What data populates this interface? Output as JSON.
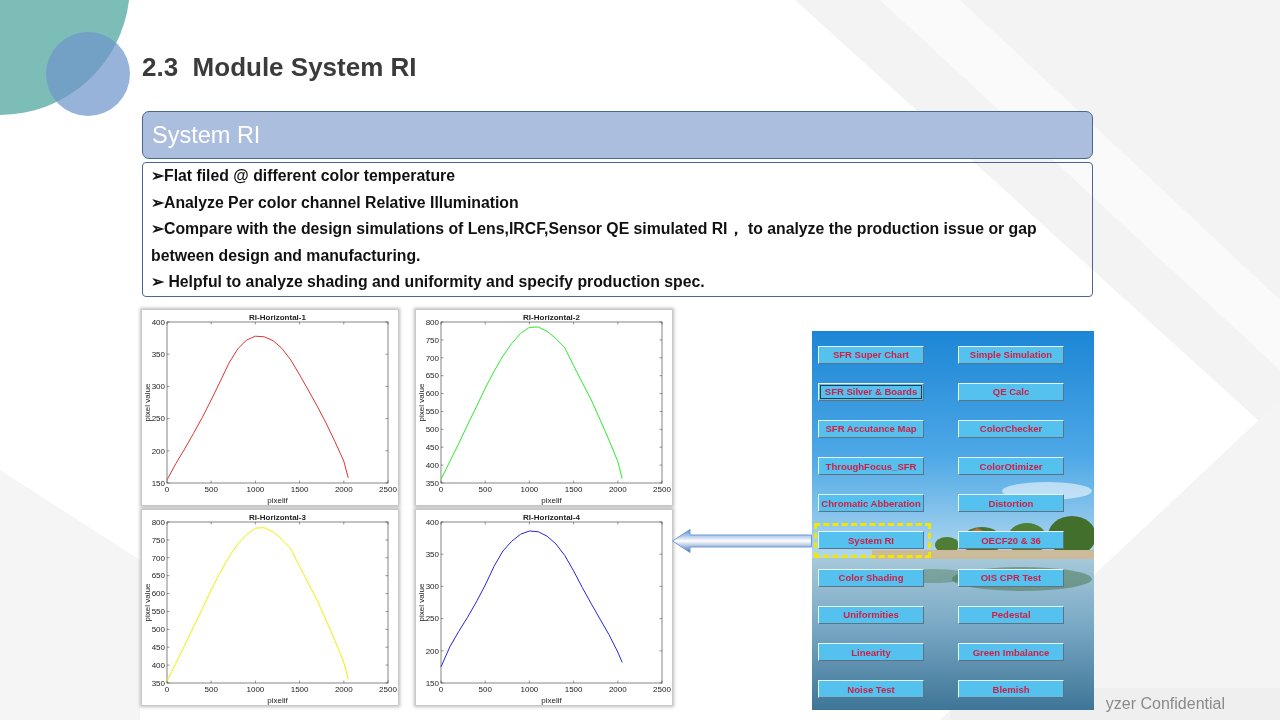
{
  "slide": {
    "title": "2.3  Module System RI"
  },
  "section_header": {
    "title": "System RI"
  },
  "bullets": [
    "➢Flat filed @ different color temperature",
    "➢Analyze Per color channel Relative Illumination",
    "➢Compare with the design simulations of Lens,IRCF,Sensor QE simulated RI， to analyze the production issue or gap between design and manufacturing.",
    "➢ Helpful to analyze shading and uniformity and specify production spec."
  ],
  "charts": [
    {
      "chart_data": {
        "type": "line",
        "title": "RI-Horizontal-1",
        "xlabel": "pixelif",
        "ylabel": "pixel value",
        "x": [
          0,
          100,
          200,
          300,
          400,
          500,
          600,
          700,
          800,
          900,
          1000,
          1100,
          1200,
          1300,
          1400,
          1500,
          1600,
          1700,
          1800,
          1900,
          2000,
          2050
        ],
        "series": [
          {
            "color": "#e0352f",
            "values": [
              155,
              180,
              203,
              227,
              252,
              279,
              307,
              336,
              358,
              372,
              378,
              377,
              371,
              359,
              341,
              318,
              294,
              269,
              243,
              214,
              184,
              158
            ]
          }
        ],
        "xlim": [
          0,
          2500
        ],
        "ylim": [
          150,
          400
        ],
        "xticks": [
          0,
          500,
          1000,
          1500,
          2000,
          2500
        ],
        "yticks": [
          150,
          200,
          250,
          300,
          350,
          400
        ]
      }
    },
    {
      "chart_data": {
        "type": "line",
        "title": "RI-Horizontal-2",
        "xlabel": "pixelif",
        "ylabel": "pixel value",
        "x": [
          0,
          100,
          200,
          300,
          400,
          500,
          600,
          700,
          800,
          900,
          1000,
          1100,
          1200,
          1300,
          1400,
          1500,
          1600,
          1700,
          1800,
          1900,
          2000,
          2050
        ],
        "series": [
          {
            "color": "#2ee82e",
            "values": [
              360,
              410,
              460,
              512,
              563,
              615,
              662,
              705,
              740,
              768,
              785,
              786,
              774,
              754,
              728,
              678,
              630,
              582,
              527,
              470,
              410,
              362
            ]
          }
        ],
        "xlim": [
          0,
          2500
        ],
        "ylim": [
          350,
          800
        ],
        "xticks": [
          0,
          500,
          1000,
          1500,
          2000,
          2500
        ],
        "yticks": [
          350,
          400,
          450,
          500,
          550,
          600,
          650,
          700,
          750,
          800
        ]
      }
    },
    {
      "chart_data": {
        "type": "line",
        "title": "RI-Horizontal-3",
        "xlabel": "pixelif",
        "ylabel": "pixel value",
        "x": [
          0,
          100,
          200,
          300,
          400,
          500,
          600,
          700,
          800,
          900,
          1000,
          1100,
          1200,
          1300,
          1400,
          1500,
          1600,
          1700,
          1800,
          1900,
          2000,
          2050
        ],
        "series": [
          {
            "color": "#f0f000",
            "values": [
              355,
              405,
              455,
              507,
              558,
              610,
              658,
              702,
              738,
              765,
              783,
              784,
              772,
              752,
              725,
              676,
              628,
              580,
              525,
              468,
              408,
              360
            ]
          }
        ],
        "xlim": [
          0,
          2500
        ],
        "ylim": [
          350,
          800
        ],
        "xticks": [
          0,
          500,
          1000,
          1500,
          2000,
          2500
        ],
        "yticks": [
          350,
          400,
          450,
          500,
          550,
          600,
          650,
          700,
          750,
          800
        ]
      }
    },
    {
      "chart_data": {
        "type": "line",
        "title": "RI-Horizontal-4",
        "xlabel": "pixelif",
        "ylabel": "pixel value",
        "x": [
          0,
          100,
          200,
          300,
          400,
          500,
          600,
          700,
          800,
          900,
          1000,
          1100,
          1200,
          1300,
          1400,
          1500,
          1600,
          1700,
          1800,
          1900,
          2000,
          2050
        ],
        "series": [
          {
            "color": "#2626d8",
            "values": [
              175,
              206,
              230,
              252,
              276,
              302,
              331,
              355,
              370,
              381,
              386,
              385,
              378,
              366,
              348,
              324,
              298,
              273,
              249,
              225,
              198,
              182
            ]
          }
        ],
        "xlim": [
          0,
          2500
        ],
        "ylim": [
          150,
          400
        ],
        "xticks": [
          0,
          500,
          1000,
          1500,
          2000,
          2500
        ],
        "yticks": [
          150,
          200,
          250,
          300,
          350,
          400
        ]
      }
    }
  ],
  "tool_panel": {
    "buttons": [
      {
        "label": "SFR Super Chart",
        "focused": false,
        "highlighted": false
      },
      {
        "label": "Simple Simulation",
        "focused": false,
        "highlighted": false
      },
      {
        "label": "SFR Silver & Boards",
        "focused": true,
        "highlighted": false
      },
      {
        "label": "QE Calc",
        "focused": false,
        "highlighted": false
      },
      {
        "label": "SFR Accutance Map",
        "focused": false,
        "highlighted": false
      },
      {
        "label": "ColorChecker",
        "focused": false,
        "highlighted": false
      },
      {
        "label": "ThroughFocus_SFR",
        "focused": false,
        "highlighted": false
      },
      {
        "label": "ColorOtimizer",
        "focused": false,
        "highlighted": false
      },
      {
        "label": "Chromatic Abberation",
        "focused": false,
        "highlighted": false
      },
      {
        "label": "Distortion",
        "focused": false,
        "highlighted": false
      },
      {
        "label": "System RI",
        "focused": false,
        "highlighted": true
      },
      {
        "label": "OECF20 & 36",
        "focused": false,
        "highlighted": false
      },
      {
        "label": "Color Shading",
        "focused": false,
        "highlighted": false
      },
      {
        "label": "OIS CPR Test",
        "focused": false,
        "highlighted": false
      },
      {
        "label": "Uniformities",
        "focused": false,
        "highlighted": false
      },
      {
        "label": "Pedestal",
        "focused": false,
        "highlighted": false
      },
      {
        "label": "Linearity",
        "focused": false,
        "highlighted": false
      },
      {
        "label": "Green Imbalance",
        "focused": false,
        "highlighted": false
      },
      {
        "label": "Noise Test",
        "focused": false,
        "highlighted": false
      },
      {
        "label": "Blemish",
        "focused": false,
        "highlighted": false
      }
    ]
  },
  "footer": {
    "text": "yzer Confidential"
  }
}
